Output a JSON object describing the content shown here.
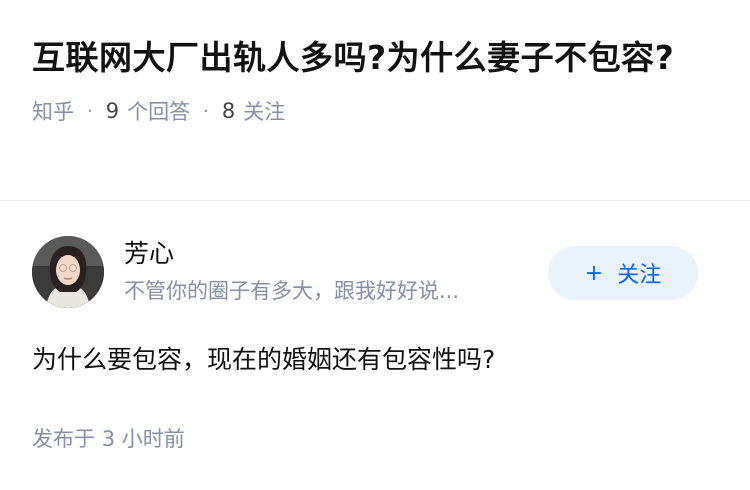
{
  "question": {
    "title": "互联网大厂出轨人多吗?为什么妻子不包容?",
    "source": "知乎",
    "answer_count": "9",
    "answer_label": "个回答",
    "follower_count": "8",
    "follower_label": "关注"
  },
  "author": {
    "name": "芳心",
    "bio": "不管你的圈子有多大，跟我好好说..."
  },
  "follow_button": {
    "plus": "+",
    "label": "关注"
  },
  "answer": {
    "content": "为什么要包容，现在的婚姻还有包容性吗?",
    "time_label": "发布于",
    "time_value": "3",
    "time_unit": "小时前"
  },
  "colors": {
    "accent": "#0066ff",
    "button_bg": "#eaf2fb",
    "meta_text": "#8590a6"
  }
}
